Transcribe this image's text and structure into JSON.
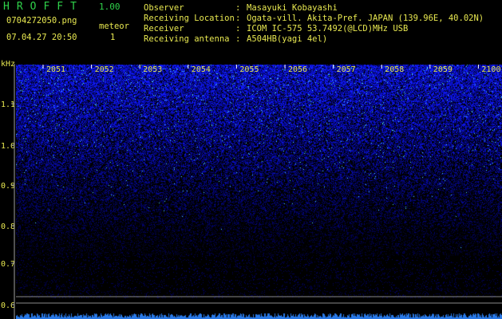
{
  "app": {
    "title": "HROFFT",
    "version": "1.00"
  },
  "file": {
    "name": "0704272050.png",
    "datetime": "07.04.27 20:50"
  },
  "meteor": {
    "label": "meteor",
    "count": "1"
  },
  "info": [
    {
      "label": "Observer",
      "value": "Masayuki Kobayashi"
    },
    {
      "label": "Receiving Location",
      "value": "Ogata-vill. Akita-Pref. JAPAN (139.96E, 40.02N)"
    },
    {
      "label": "Receiver",
      "value": "ICOM IC-575 53.7492(@LCD)MHz USB"
    },
    {
      "label": "Receiving antenna",
      "value": "A504HB(yagi 4el)"
    }
  ],
  "spectrogram": {
    "unit": "kHz",
    "time_labels": [
      "2051",
      "2052",
      "2053",
      "2054",
      "2055",
      "2056",
      "2057",
      "2058",
      "2059",
      "2100"
    ],
    "freq_labels": [
      "1.1",
      "1.0",
      "0.9",
      "0.8",
      "0.7",
      "0.6"
    ],
    "colors": {
      "noise_high": "#1f3cff",
      "noise_low": "#0a1470",
      "background": "#000000",
      "grid": "#a0a0a0",
      "labels": "#e8e850"
    }
  }
}
